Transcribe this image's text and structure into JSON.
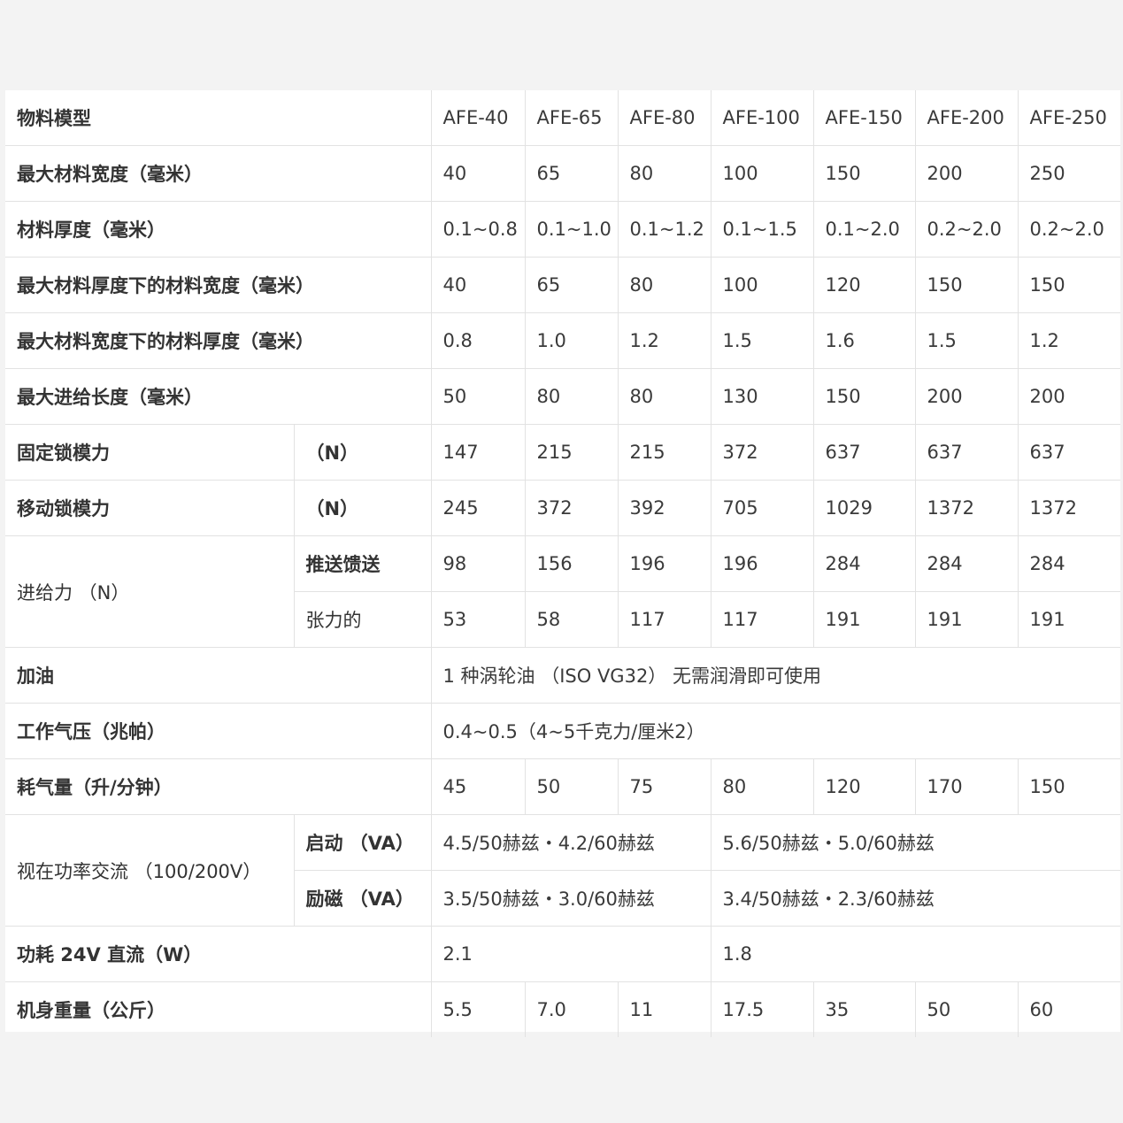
{
  "spec_table": {
    "header": {
      "label": "物料模型",
      "models": [
        "AFE-40",
        "AFE-65",
        "AFE-80",
        "AFE-100",
        "AFE-150",
        "AFE-200",
        "AFE-250"
      ]
    },
    "max_material_width": {
      "label": "最大材料宽度（毫米）",
      "values": [
        "40",
        "65",
        "80",
        "100",
        "150",
        "200",
        "250"
      ]
    },
    "material_thickness": {
      "label": "材料厚度（毫米）",
      "values": [
        "0.1~0.8",
        "0.1~1.0",
        "0.1~1.2",
        "0.1~1.5",
        "0.1~2.0",
        "0.2~2.0",
        "0.2~2.0"
      ]
    },
    "width_at_max_thickness": {
      "label": "最大材料厚度下的材料宽度（毫米）",
      "values": [
        "40",
        "65",
        "80",
        "100",
        "120",
        "150",
        "150"
      ]
    },
    "thickness_at_max_width": {
      "label": "最大材料宽度下的材料厚度（毫米）",
      "values": [
        "0.8",
        "1.0",
        "1.2",
        "1.5",
        "1.6",
        "1.5",
        "1.2"
      ]
    },
    "max_feed_length": {
      "label": "最大进给长度（毫米）",
      "values": [
        "50",
        "80",
        "80",
        "130",
        "150",
        "200",
        "200"
      ]
    },
    "fixed_clamp_force": {
      "label": "固定锁模力",
      "unit": "（N）",
      "values": [
        "147",
        "215",
        "215",
        "372",
        "637",
        "637",
        "637"
      ]
    },
    "moving_clamp_force": {
      "label": "移动锁模力",
      "unit": "（N）",
      "values": [
        "245",
        "372",
        "392",
        "705",
        "1029",
        "1372",
        "1372"
      ]
    },
    "feed_force": {
      "label": "进给力 （N）",
      "push": {
        "label": "推送馈送",
        "values": [
          "98",
          "156",
          "196",
          "196",
          "284",
          "284",
          "284"
        ]
      },
      "tension": {
        "label": "张力的",
        "values": [
          "53",
          "58",
          "117",
          "117",
          "191",
          "191",
          "191"
        ]
      }
    },
    "lubrication": {
      "label": "加油",
      "value": "1 种涡轮油 （ISO VG32） 无需润滑即可使用"
    },
    "working_pressure": {
      "label": "工作气压（兆帕）",
      "value": "0.4~0.5（4~5千克力/厘米2）"
    },
    "air_consumption": {
      "label": "耗气量（升/分钟）",
      "values": [
        "45",
        "50",
        "75",
        "80",
        "120",
        "170",
        "150"
      ]
    },
    "apparent_power": {
      "label": "视在功率交流 （100/200V）",
      "start": {
        "label": "启动 （VA）",
        "small": "4.5/50赫兹・4.2/60赫兹",
        "large": "5.6/50赫兹・5.0/60赫兹"
      },
      "excite": {
        "label": "励磁 （VA）",
        "small": "3.5/50赫兹・3.0/60赫兹",
        "large": "3.4/50赫兹・2.3/60赫兹"
      }
    },
    "power_consumption": {
      "label": "功耗 24V 直流（W）",
      "small": "2.1",
      "large": "1.8"
    },
    "weight": {
      "label": "机身重量（公斤）",
      "values": [
        "5.5",
        "7.0",
        "11",
        "17.5",
        "35",
        "50",
        "60"
      ]
    }
  }
}
